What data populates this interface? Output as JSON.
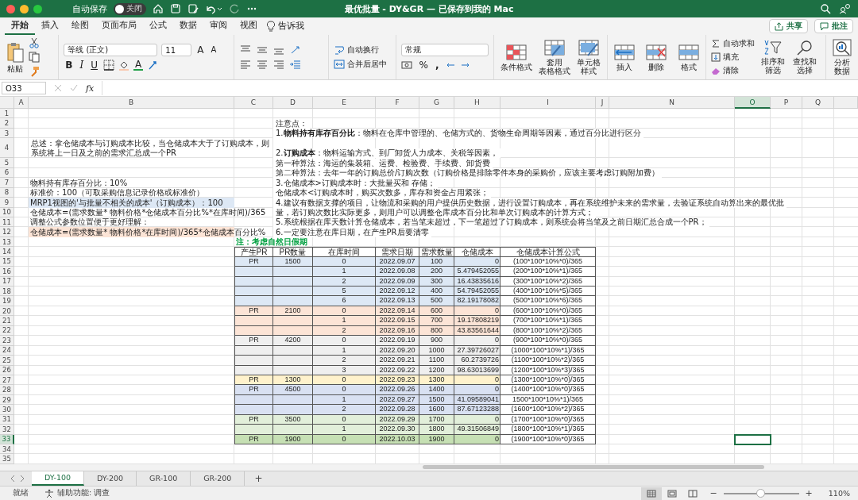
{
  "window": {
    "autosave": {
      "label": "自动保存",
      "toggle": "关闭",
      "on": false
    },
    "title": "最优批量 - DY&GR — 已保存到我的 Mac"
  },
  "menu_tabs": [
    {
      "label": "开始",
      "selected": true
    },
    {
      "label": "插入",
      "selected": false
    },
    {
      "label": "绘图",
      "selected": false
    },
    {
      "label": "页面布局",
      "selected": false
    },
    {
      "label": "公式",
      "selected": false
    },
    {
      "label": "数据",
      "selected": false
    },
    {
      "label": "审阅",
      "selected": false
    },
    {
      "label": "视图",
      "selected": false
    }
  ],
  "tell_me": "告诉我",
  "share_button": "共享",
  "comments_button": "批注",
  "ribbon": {
    "paste": "粘贴",
    "font": "等线 (正文)",
    "font_size": "11",
    "grow": "A",
    "shrink": "A",
    "bold": "B",
    "italic": "I",
    "underline": "U",
    "font_color": "A",
    "wrap": "自动换行",
    "merge": "合并后居中",
    "number_format": "常规",
    "percent": "%",
    "comma": ",",
    "styles": [
      [
        "条件格式"
      ],
      [
        "套用",
        "表格格式"
      ],
      [
        "单元格",
        "样式"
      ]
    ],
    "cells": [
      [
        "插入"
      ],
      [
        "删除"
      ],
      [
        "格式"
      ]
    ],
    "autosum": "自动求和",
    "fill": "填充",
    "clear": "清除",
    "sort": [
      "排序和",
      "筛选"
    ],
    "find": [
      "查找和",
      "选择"
    ],
    "analyze": [
      "分析",
      "数据"
    ]
  },
  "formula_bar": {
    "cell": "O33",
    "fx": "fx"
  },
  "sheet": {
    "columns": [
      {
        "label": "A",
        "selected": false
      },
      {
        "label": "B",
        "selected": false
      },
      {
        "label": "C",
        "selected": false
      },
      {
        "label": "D",
        "selected": false
      },
      {
        "label": "E",
        "selected": false
      },
      {
        "label": "F",
        "selected": false
      },
      {
        "label": "G",
        "selected": false
      },
      {
        "label": "H",
        "selected": false
      },
      {
        "label": "I",
        "selected": false
      },
      {
        "label": "J",
        "selected": false
      },
      {
        "label": "N",
        "selected": false
      },
      {
        "label": "O",
        "selected": true
      },
      {
        "label": "P",
        "selected": false
      },
      {
        "label": "Q",
        "selected": false
      }
    ],
    "rows": [
      {
        "label": "1",
        "selected": false
      },
      {
        "label": "2",
        "selected": false
      },
      {
        "label": "3",
        "selected": false
      },
      {
        "label": "4",
        "selected": false
      },
      {
        "label": "5",
        "selected": false
      },
      {
        "label": "6",
        "selected": false
      },
      {
        "label": "7",
        "selected": false
      },
      {
        "label": "8",
        "selected": false
      },
      {
        "label": "9",
        "selected": false
      },
      {
        "label": "10",
        "selected": false
      },
      {
        "label": "11",
        "selected": false
      },
      {
        "label": "12",
        "selected": false
      },
      {
        "label": "13",
        "selected": false
      },
      {
        "label": "14",
        "selected": false
      },
      {
        "label": "15",
        "selected": false
      },
      {
        "label": "16",
        "selected": false
      },
      {
        "label": "17",
        "selected": false
      },
      {
        "label": "18",
        "selected": false
      },
      {
        "label": "19",
        "selected": false
      },
      {
        "label": "20",
        "selected": false
      },
      {
        "label": "21",
        "selected": false
      },
      {
        "label": "22",
        "selected": false
      },
      {
        "label": "23",
        "selected": false
      },
      {
        "label": "24",
        "selected": false
      },
      {
        "label": "25",
        "selected": false
      },
      {
        "label": "26",
        "selected": false
      },
      {
        "label": "27",
        "selected": false
      },
      {
        "label": "28",
        "selected": false
      },
      {
        "label": "29",
        "selected": false
      },
      {
        "label": "30",
        "selected": false
      },
      {
        "label": "31",
        "selected": false
      },
      {
        "label": "32",
        "selected": false
      },
      {
        "label": "33",
        "selected": true
      },
      {
        "label": "34",
        "selected": false
      },
      {
        "label": "35",
        "selected": false
      }
    ],
    "left_notes": [
      {
        "text": "总述：拿仓储成本与订购成本比较，当仓储成本大于了订购成本，则系统将上一日及之前的需求汇总成一个PR"
      },
      {
        "text": "物料持有库存百分比：10%"
      },
      {
        "text": "标准价：100（可取采购信息记录价格或标准价）"
      },
      {
        "text": "MRP1视图的'与批量不相关的成本'（订购成本）：100",
        "color": "#dde8f5"
      },
      {
        "text": "仓储成本=(需求数量* 物料价格*仓储成本百分比%*在库时间)/365"
      },
      {
        "text": "调整公式参数位置便于更好理解："
      },
      {
        "text": "仓储成本=(需求数量* 物料价格*在库时间)/365*仓储成本百分比%",
        "color": "#fce4d6"
      }
    ],
    "notes": [
      "注意点：",
      "1.**物料持有库存百分比**：物料在仓库中管理的、仓储方式的、货物生命周期等因素，通过百分比进行区分",
      "2.**订购成本**：物料运输方式、到厂卸货人力成本、关税等因素，",
      "第一种算法：海运的集装箱、运费、检验费、手续费、卸货费",
      "第二种算法：去年一年的订购总价/订购次数（订购价格是排除零件本身的采购价，应该主要考虑订购附加费）",
      "3.仓储成本>订购成本时：大批量买和 存储；",
      "仓储成本<订购成本时，购买次数多，库存和资金占用紧张；",
      "4.建议有数据支撑的项目，让物流和采购的用户提供历史数据，进行设置订购成本，再在系统维护未来的需求量，去验证系统自动算出来的最优批",
      "量，若订购次数比实际更多，则用户可以调整仓库成本百分比和单次订购成本的计算方式；",
      "5.系统根据在库天数计算仓储成本，若当笔未超过，下一笔超过了订购成本，则系统会将当笔及之前日期汇总合成一个PR；",
      "6.一定要注意在库日期，在产生PR后要清零"
    ],
    "table": {
      "note": "注：考虑自然日假期",
      "headers": [
        "产生PR",
        "PR数量",
        "在库时间",
        "需求日期",
        "需求数量",
        "仓储成本",
        "仓储成本计算公式"
      ],
      "rows": [
        {
          "color": "#dde8f5",
          "pr": "PR",
          "pr_qty": "1500",
          "days": "0",
          "date": "2022.09.07",
          "qty": "100",
          "cost": "0",
          "formula": "(100*100*10%*0)/365"
        },
        {
          "color": "#dde8f5",
          "days": "1",
          "date": "2022.09.08",
          "qty": "200",
          "cost": "5.479452055",
          "formula": "(200*100*10%*1)/365"
        },
        {
          "color": "#dde8f5",
          "days": "2",
          "date": "2022.09.09",
          "qty": "300",
          "cost": "16.43835616",
          "formula": "(300*100*10%*2)/365"
        },
        {
          "color": "#dde8f5",
          "days": "5",
          "date": "2022.09.12",
          "qty": "400",
          "cost": "54.79452055",
          "formula": "(400*100*10%*5)/365"
        },
        {
          "color": "#dde8f5",
          "days": "6",
          "date": "2022.09.13",
          "qty": "500",
          "cost": "82.19178082",
          "formula": "(500*100*10%*6)/365"
        },
        {
          "color": "#fce4d6",
          "pr": "PR",
          "pr_qty": "2100",
          "days": "0",
          "date": "2022.09.14",
          "qty": "600",
          "cost": "0",
          "formula": "(600*100*10%*0)/365"
        },
        {
          "color": "#fce4d6",
          "days": "1",
          "date": "2022.09.15",
          "qty": "700",
          "cost": "19.17808219",
          "formula": "(700*100*10%*1)/365"
        },
        {
          "color": "#fce4d6",
          "days": "2",
          "date": "2022.09.16",
          "qty": "800",
          "cost": "43.83561644",
          "formula": "(800*100*10%*2)/365"
        },
        {
          "color": "#efefef",
          "pr": "PR",
          "pr_qty": "4200",
          "days": "0",
          "date": "2022.09.19",
          "qty": "900",
          "cost": "0",
          "formula": "(900*100*10%*0)/365"
        },
        {
          "color": "#efefef",
          "days": "1",
          "date": "2022.09.20",
          "qty": "1000",
          "cost": "27.39726027",
          "formula": "(1000*100*10%*1)/365"
        },
        {
          "color": "#efefef",
          "days": "2",
          "date": "2022.09.21",
          "qty": "1100",
          "cost": "60.2739726",
          "formula": "(1100*100*10%*2)/365"
        },
        {
          "color": "#efefef",
          "days": "3",
          "date": "2022.09.22",
          "qty": "1200",
          "cost": "98.63013699",
          "formula": "(1200*100*10%*3)/365"
        },
        {
          "color": "#fff2cc",
          "pr": "PR",
          "pr_qty": "1300",
          "days": "0",
          "date": "2022.09.23",
          "qty": "1300",
          "cost": "0",
          "formula": "(1300*100*10%*0)/365"
        },
        {
          "color": "#d9e1f2",
          "pr": "PR",
          "pr_qty": "4500",
          "days": "0",
          "date": "2022.09.26",
          "qty": "1400",
          "cost": "0",
          "formula": "(1400*100*10%*0)/365"
        },
        {
          "color": "#d9e1f2",
          "days": "1",
          "date": "2022.09.27",
          "qty": "1500",
          "cost": "41.09589041",
          "formula": "1500*100*10%*1)/365"
        },
        {
          "color": "#d9e1f2",
          "days": "2",
          "date": "2022.09.28",
          "qty": "1600",
          "cost": "87.67123288",
          "formula": "(1600*100*10%*2)/365"
        },
        {
          "color": "#e2efda",
          "pr": "PR",
          "pr_qty": "3500",
          "days": "0",
          "date": "2022.09.29",
          "qty": "1700",
          "cost": "0",
          "formula": "(1700*100*10%*0)/365"
        },
        {
          "color": "#e2efda",
          "days": "1",
          "date": "2022.09.30",
          "qty": "1800",
          "cost": "49.31506849",
          "formula": "(1800*100*10%*1)/365"
        },
        {
          "color": "#c6e0b4",
          "pr": "PR",
          "pr_qty": "1900",
          "days": "0",
          "date": "2022.10.03",
          "qty": "1900",
          "cost": "0",
          "formula": "(1900*100*10%*0)/365"
        }
      ]
    }
  },
  "sheet_tabs": [
    {
      "label": "DY-100",
      "selected": true
    },
    {
      "label": "DY-200",
      "selected": false
    },
    {
      "label": "GR-100",
      "selected": false
    },
    {
      "label": "GR-200",
      "selected": false
    }
  ],
  "add_sheet": "+",
  "status": {
    "ready": "就绪",
    "accessibility": "辅助功能: 调查",
    "zoom_out": "−",
    "zoom_in": "+",
    "zoom": "110%",
    "zoom_slider": {
      "level": 0.5
    }
  }
}
